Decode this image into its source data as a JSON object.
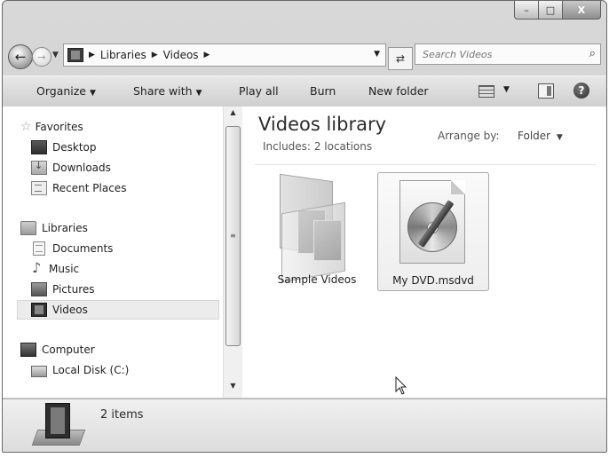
{
  "window": {
    "caption": {
      "minimize": "–",
      "maximize": "□",
      "close": "X"
    }
  },
  "address_bar": {
    "crumbs": [
      "Libraries",
      "Videos"
    ],
    "separator": "▶",
    "dropdown": "▼",
    "refresh": "⇄"
  },
  "search": {
    "placeholder": "Search Videos",
    "icon": "⌕"
  },
  "toolbar": {
    "organize": "Organize",
    "share_with": "Share with",
    "play_all": "Play all",
    "burn": "Burn",
    "new_folder": "New folder",
    "caret": "▼",
    "help": "?"
  },
  "nav": {
    "favorites": {
      "label": "Favorites",
      "items": [
        "Desktop",
        "Downloads",
        "Recent Places"
      ]
    },
    "libraries": {
      "label": "Libraries",
      "items": [
        "Documents",
        "Music",
        "Pictures",
        "Videos"
      ],
      "selected": "Videos"
    },
    "computer": {
      "label": "Computer",
      "items": [
        "Local Disk (C:)"
      ]
    }
  },
  "scrollbar": {
    "up": "▲",
    "down": "▼",
    "grip": "≡"
  },
  "library": {
    "title": "Videos library",
    "includes": "Includes:",
    "locations": "2 locations",
    "arrange_label": "Arrange by:",
    "arrange_value": "Folder",
    "arrange_caret": "▼"
  },
  "files": [
    {
      "name": "Sample Videos",
      "type": "folder",
      "selected": false
    },
    {
      "name": "My DVD.msdvd",
      "type": "dvd-project",
      "selected": true
    }
  ],
  "details": {
    "count": "2 items"
  }
}
